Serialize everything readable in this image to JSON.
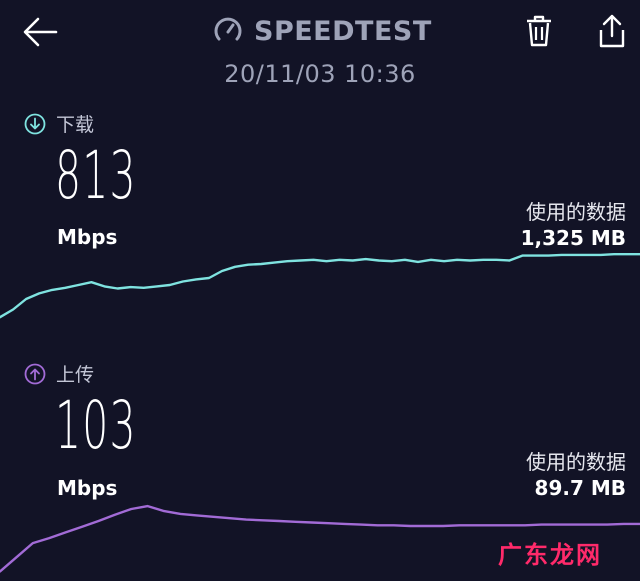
{
  "header": {
    "title": "SPEEDTEST",
    "datetime": "20/11/03 10:36"
  },
  "download": {
    "label": "下载",
    "value": "813",
    "unit": "Mbps",
    "data_used_label": "使用的数据",
    "data_used_value": "1,325 MB",
    "color": "#7fe3e0",
    "trend": [
      0.04,
      0.15,
      0.3,
      0.38,
      0.43,
      0.46,
      0.5,
      0.54,
      0.48,
      0.45,
      0.47,
      0.46,
      0.48,
      0.5,
      0.55,
      0.58,
      0.6,
      0.7,
      0.76,
      0.79,
      0.8,
      0.82,
      0.84,
      0.85,
      0.86,
      0.84,
      0.86,
      0.85,
      0.87,
      0.85,
      0.84,
      0.86,
      0.83,
      0.86,
      0.84,
      0.86,
      0.85,
      0.86,
      0.86,
      0.85,
      0.92,
      0.92,
      0.92,
      0.93,
      0.93,
      0.93,
      0.93,
      0.94,
      0.94,
      0.94
    ]
  },
  "upload": {
    "label": "上传",
    "value": "103",
    "unit": "Mbps",
    "data_used_label": "使用的数据",
    "data_used_value": "89.7 MB",
    "color": "#a26bd6",
    "trend": [
      0.05,
      0.25,
      0.45,
      0.52,
      0.6,
      0.68,
      0.76,
      0.85,
      0.93,
      0.97,
      0.9,
      0.86,
      0.84,
      0.82,
      0.8,
      0.78,
      0.77,
      0.76,
      0.75,
      0.74,
      0.73,
      0.72,
      0.71,
      0.7,
      0.7,
      0.69,
      0.69,
      0.69,
      0.7,
      0.7,
      0.7,
      0.7,
      0.7,
      0.71,
      0.71,
      0.71,
      0.71,
      0.71,
      0.72,
      0.72
    ]
  },
  "watermark": "广东龙网"
}
